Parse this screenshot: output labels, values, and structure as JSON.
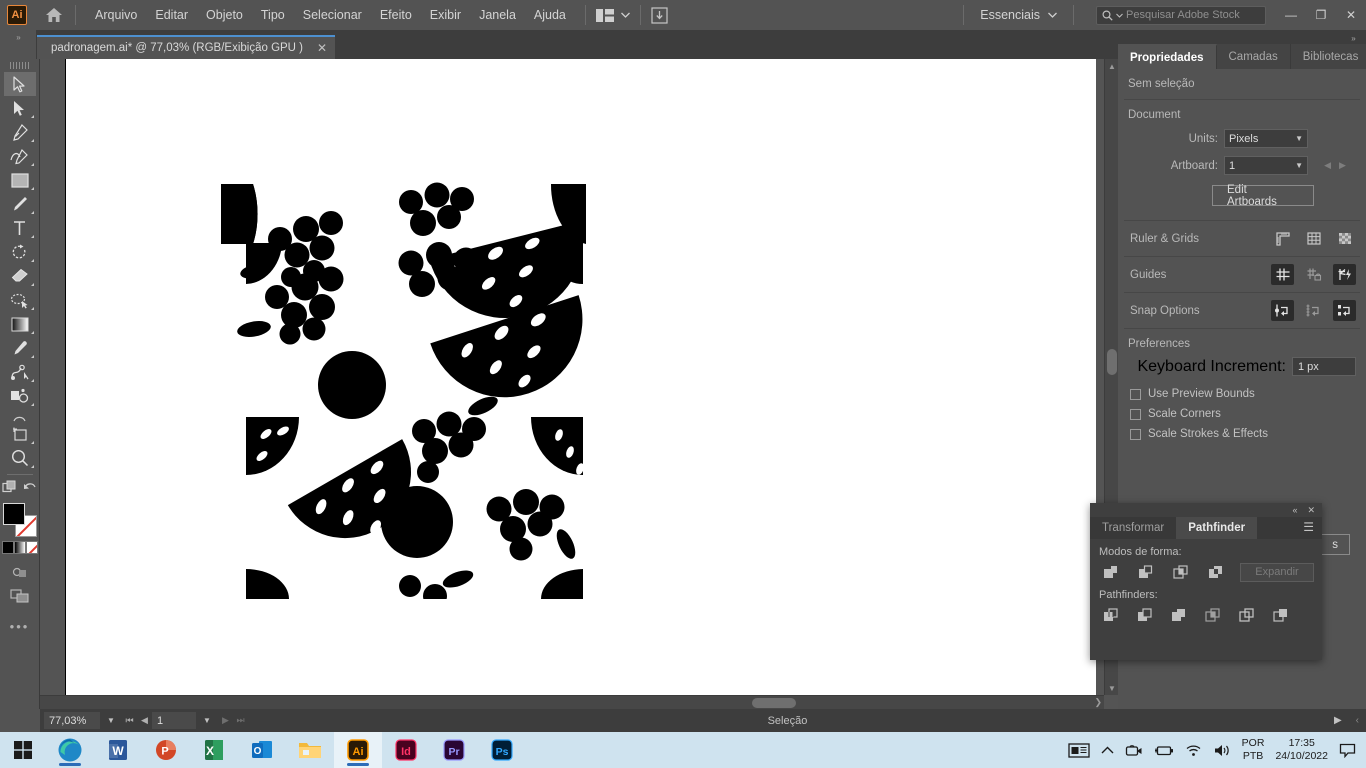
{
  "menubar": {
    "logo": "Ai",
    "home_icon": "home-icon",
    "items": [
      "Arquivo",
      "Editar",
      "Objeto",
      "Tipo",
      "Selecionar",
      "Efeito",
      "Exibir",
      "Janela",
      "Ajuda"
    ],
    "arrange_icon": "arrange-documents-icon",
    "stock_icon": "stock-download-icon",
    "workspace": "Essenciais",
    "search_placeholder": "Pesquisar Adobe Stock",
    "minimize": "minimize-icon",
    "maximize": "maximize-icon",
    "close": "close-icon"
  },
  "tabbar": {
    "collapse_left": "»",
    "collapse_right": "»",
    "document_title": "padronagem.ai* @ 77,03% (RGB/Exibição GPU )",
    "close_tab": "✕"
  },
  "toolbar": {
    "tools": [
      {
        "name": "selection-tool",
        "selected": true
      },
      {
        "name": "direct-selection-tool",
        "selected": false
      },
      {
        "name": "pen-tool",
        "selected": false
      },
      {
        "name": "curvature-tool",
        "selected": false
      },
      {
        "name": "rectangle-tool",
        "selected": false
      },
      {
        "name": "paintbrush-tool",
        "selected": false
      },
      {
        "name": "type-tool",
        "selected": false
      },
      {
        "name": "rotate-tool",
        "selected": false
      },
      {
        "name": "eraser-tool",
        "selected": false
      },
      {
        "name": "shaper-tool",
        "selected": false
      },
      {
        "name": "gradient-tool",
        "selected": false
      },
      {
        "name": "eyedropper-tool",
        "selected": false
      },
      {
        "name": "blend-tool",
        "selected": false
      },
      {
        "name": "symbol-sprayer-tool",
        "selected": false
      },
      {
        "name": "artboard-tool",
        "selected": false
      },
      {
        "name": "zoom-tool",
        "selected": false
      }
    ],
    "fill_color": "#000000",
    "stroke_color": "none",
    "more_tools": "•••"
  },
  "properties_panel": {
    "tabs": [
      {
        "label": "Propriedades",
        "active": true
      },
      {
        "label": "Camadas",
        "active": false
      },
      {
        "label": "Bibliotecas",
        "active": false
      }
    ],
    "selection_status": "Sem seleção",
    "document_heading": "Document",
    "units_label": "Units:",
    "units_value": "Pixels",
    "artboard_label": "Artboard:",
    "artboard_value": "1",
    "edit_artboards_button": "Edit Artboards",
    "ruler_grids_label": "Ruler & Grids",
    "ruler_icons": [
      "show-rulers-icon",
      "show-grid-icon",
      "show-transparency-grid-icon"
    ],
    "guides_label": "Guides",
    "guides_icons": [
      "show-guides-icon",
      "lock-guides-icon",
      "smart-guides-icon"
    ],
    "snap_label": "Snap Options",
    "snap_icons": [
      "snap-to-point-icon",
      "snap-to-grid-icon",
      "snap-to-glyph-icon"
    ],
    "preferences_heading": "Preferences",
    "keyboard_increment_label": "Keyboard Increment:",
    "keyboard_increment_value": "1 px",
    "checkboxes": [
      {
        "label": "Use Preview Bounds",
        "checked": false
      },
      {
        "label": "Scale Corners",
        "checked": false
      },
      {
        "label": "Scale Strokes & Effects",
        "checked": false
      }
    ],
    "hidden_button_tail": "s"
  },
  "pathfinder_panel": {
    "collapse_icon": "«",
    "close_icon": "✕",
    "menu_icon": "panel-menu-icon",
    "tabs": [
      {
        "label": "Transformar",
        "active": false
      },
      {
        "label": "Pathfinder",
        "active": true
      }
    ],
    "shape_modes_label": "Modos de forma:",
    "shape_mode_icons": [
      "unite-icon",
      "minus-front-icon",
      "intersect-icon",
      "exclude-icon"
    ],
    "expand_button": "Expandir",
    "expand_enabled": false,
    "pathfinders_label": "Pathfinders:",
    "pathfinder_icons": [
      "divide-icon",
      "trim-icon",
      "merge-icon",
      "crop-icon",
      "outline-icon",
      "minus-back-icon"
    ]
  },
  "statusbar": {
    "zoom_value": "77,03%",
    "zoom_chevron": "chevron-down-icon",
    "first_page_icon": "first-artboard-icon",
    "prev_page_icon": "previous-artboard-icon",
    "page_value": "1",
    "page_chevron": "chevron-down-icon",
    "next_page_icon": "next-artboard-icon",
    "last_page_icon": "last-artboard-icon",
    "status_text": "Seleção",
    "play_icon": "▶",
    "collapse_icon": "‹"
  },
  "taskbar": {
    "start": "windows-start-icon",
    "apps": [
      {
        "name": "edge-icon",
        "label": "",
        "color": "#1a8fd1",
        "active": true
      },
      {
        "name": "word-icon",
        "label": "W",
        "color": "#2b579a",
        "active": false
      },
      {
        "name": "powerpoint-icon",
        "label": "P",
        "color": "#d24726",
        "active": false
      },
      {
        "name": "excel-icon",
        "label": "X",
        "color": "#217346",
        "active": false
      },
      {
        "name": "outlook-icon",
        "label": "O",
        "color": "#0f6cbd",
        "active": false
      },
      {
        "name": "file-explorer-icon",
        "label": "",
        "color": "#ffc95c",
        "active": false
      },
      {
        "name": "illustrator-icon",
        "label": "Ai",
        "color": "#ff9a00",
        "active": true
      },
      {
        "name": "indesign-icon",
        "label": "Id",
        "color": "#ff3366",
        "active": false
      },
      {
        "name": "premiere-icon",
        "label": "Pr",
        "color": "#9999ff",
        "active": false
      },
      {
        "name": "photoshop-icon",
        "label": "Ps",
        "color": "#31a8ff",
        "active": false
      }
    ],
    "tray": {
      "news_icon": "news-and-interests-icon",
      "chevron_icon": "show-hidden-icons-icon",
      "meet_icon": "meet-now-icon",
      "battery_icon": "battery-icon",
      "wifi_icon": "wifi-icon",
      "volume_icon": "volume-icon",
      "lang_line1": "POR",
      "lang_line2": "PTB",
      "time": "17:35",
      "date": "24/10/2022",
      "notification_icon": "notification-icon"
    }
  },
  "artwork": {
    "description": "fruit-pattern-artboard",
    "fill": "#000000",
    "background": "#ffffff"
  }
}
